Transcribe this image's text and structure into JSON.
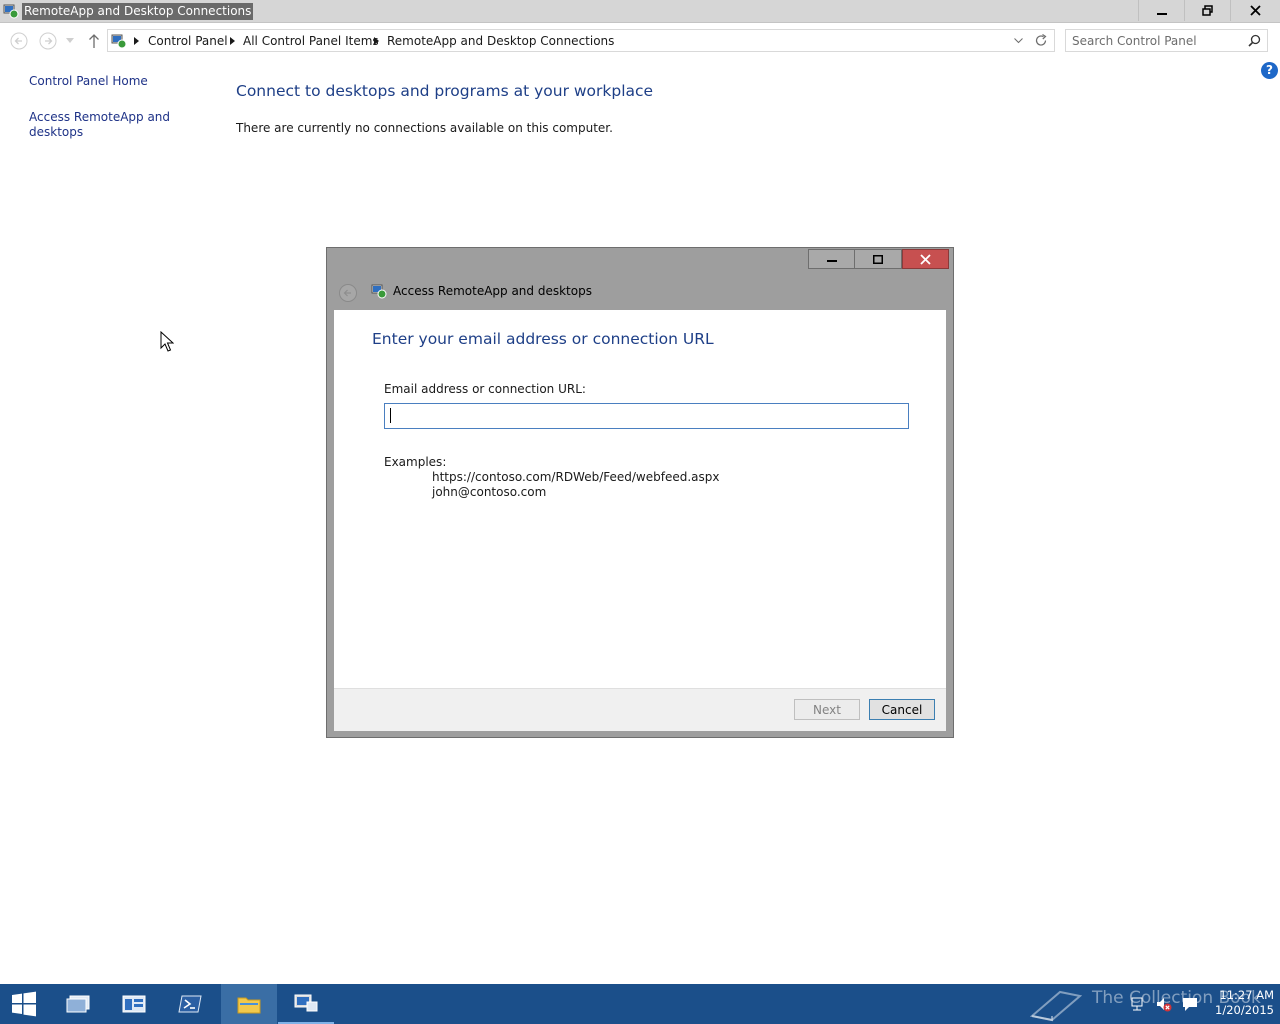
{
  "window": {
    "title": "RemoteApp and Desktop Connections"
  },
  "address": {
    "breadcrumb": [
      "Control Panel",
      "All Control Panel Items",
      "RemoteApp and Desktop Connections"
    ]
  },
  "search": {
    "placeholder": "Search Control Panel"
  },
  "left_pane": {
    "home_link": "Control Panel Home",
    "access_link_line1": "Access RemoteApp and",
    "access_link_line2": "desktops"
  },
  "main": {
    "heading": "Connect to desktops and programs at your workplace",
    "status_text": "There are currently no connections available on this computer.",
    "help_icon": "?"
  },
  "dialog": {
    "title": "Access RemoteApp and desktops",
    "heading": "Enter your email address or connection URL",
    "field_label": "Email address or connection URL:",
    "field_value": "",
    "examples_label": "Examples:",
    "examples": [
      "https://contoso.com/RDWeb/Feed/webfeed.aspx",
      "john@contoso.com"
    ],
    "next_label": "Next",
    "cancel_label": "Cancel"
  },
  "taskbar": {
    "watermark": "The Collection Book",
    "time": "11:27 AM",
    "date": "1/20/2015"
  },
  "colors": {
    "accent": "#1e3f87",
    "link": "#1e3287",
    "taskbar": "#1b4f8a",
    "close_button": "#c75050"
  }
}
